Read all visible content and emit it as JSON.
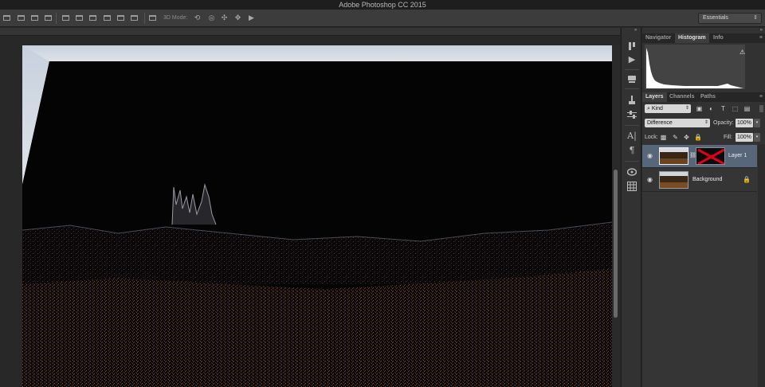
{
  "app": {
    "title": "Adobe Photoshop CC 2015"
  },
  "options_bar": {
    "mode3d_label": "3D Mode:",
    "workspace": "Essentials",
    "align_icons": [
      "align-left-edges-icon",
      "align-horizontal-centers-icon",
      "align-right-edges-icon",
      "align-top-edges-icon",
      "align-vertical-centers-icon",
      "align-bottom-edges-icon",
      "distribute-left-icon",
      "distribute-centers-icon",
      "distribute-right-icon"
    ],
    "mode3d_icons": [
      "orbit-3d-icon",
      "roll-3d-icon",
      "pan-3d-icon",
      "slide-3d-icon",
      "scale-3d-icon"
    ]
  },
  "tool_strip": {
    "icons": [
      "history-brush-icon",
      "play-actions-icon",
      "character-styles-icon",
      "brush-presets-icon",
      "adjustments-icon",
      "character-icon",
      "paragraph-icon",
      "3d-panel-icon",
      "swatches-grid-icon"
    ],
    "glyphs": [
      "A|",
      "¶"
    ]
  },
  "panels": {
    "collapse_glyph": "»",
    "menu_glyph": "≡",
    "top_tabs": [
      {
        "label": "Navigator",
        "active": false
      },
      {
        "label": "Histogram",
        "active": true
      },
      {
        "label": "Info",
        "active": false
      }
    ],
    "histogram_warning": "⚠",
    "layer_tabs": [
      {
        "label": "Layers",
        "active": true
      },
      {
        "label": "Channels",
        "active": false
      },
      {
        "label": "Paths",
        "active": false
      }
    ],
    "filter_kind": "Kind",
    "blend_mode": "Difference",
    "opacity_label": "Opacity:",
    "opacity_value": "100%",
    "lock_label": "Lock:",
    "fill_label": "Fill:",
    "fill_value": "100%",
    "layers": [
      {
        "name": "Layer 1",
        "selected": true,
        "visible": true,
        "has_mask": true,
        "locked": false
      },
      {
        "name": "Background",
        "selected": false,
        "visible": true,
        "has_mask": false,
        "locked": true
      }
    ]
  },
  "colors": {
    "app_bg": "#282828",
    "panel_bg": "#323232",
    "selection": "#58667a",
    "mask_cross": "#e0001a",
    "sky": "#c9d3df"
  }
}
